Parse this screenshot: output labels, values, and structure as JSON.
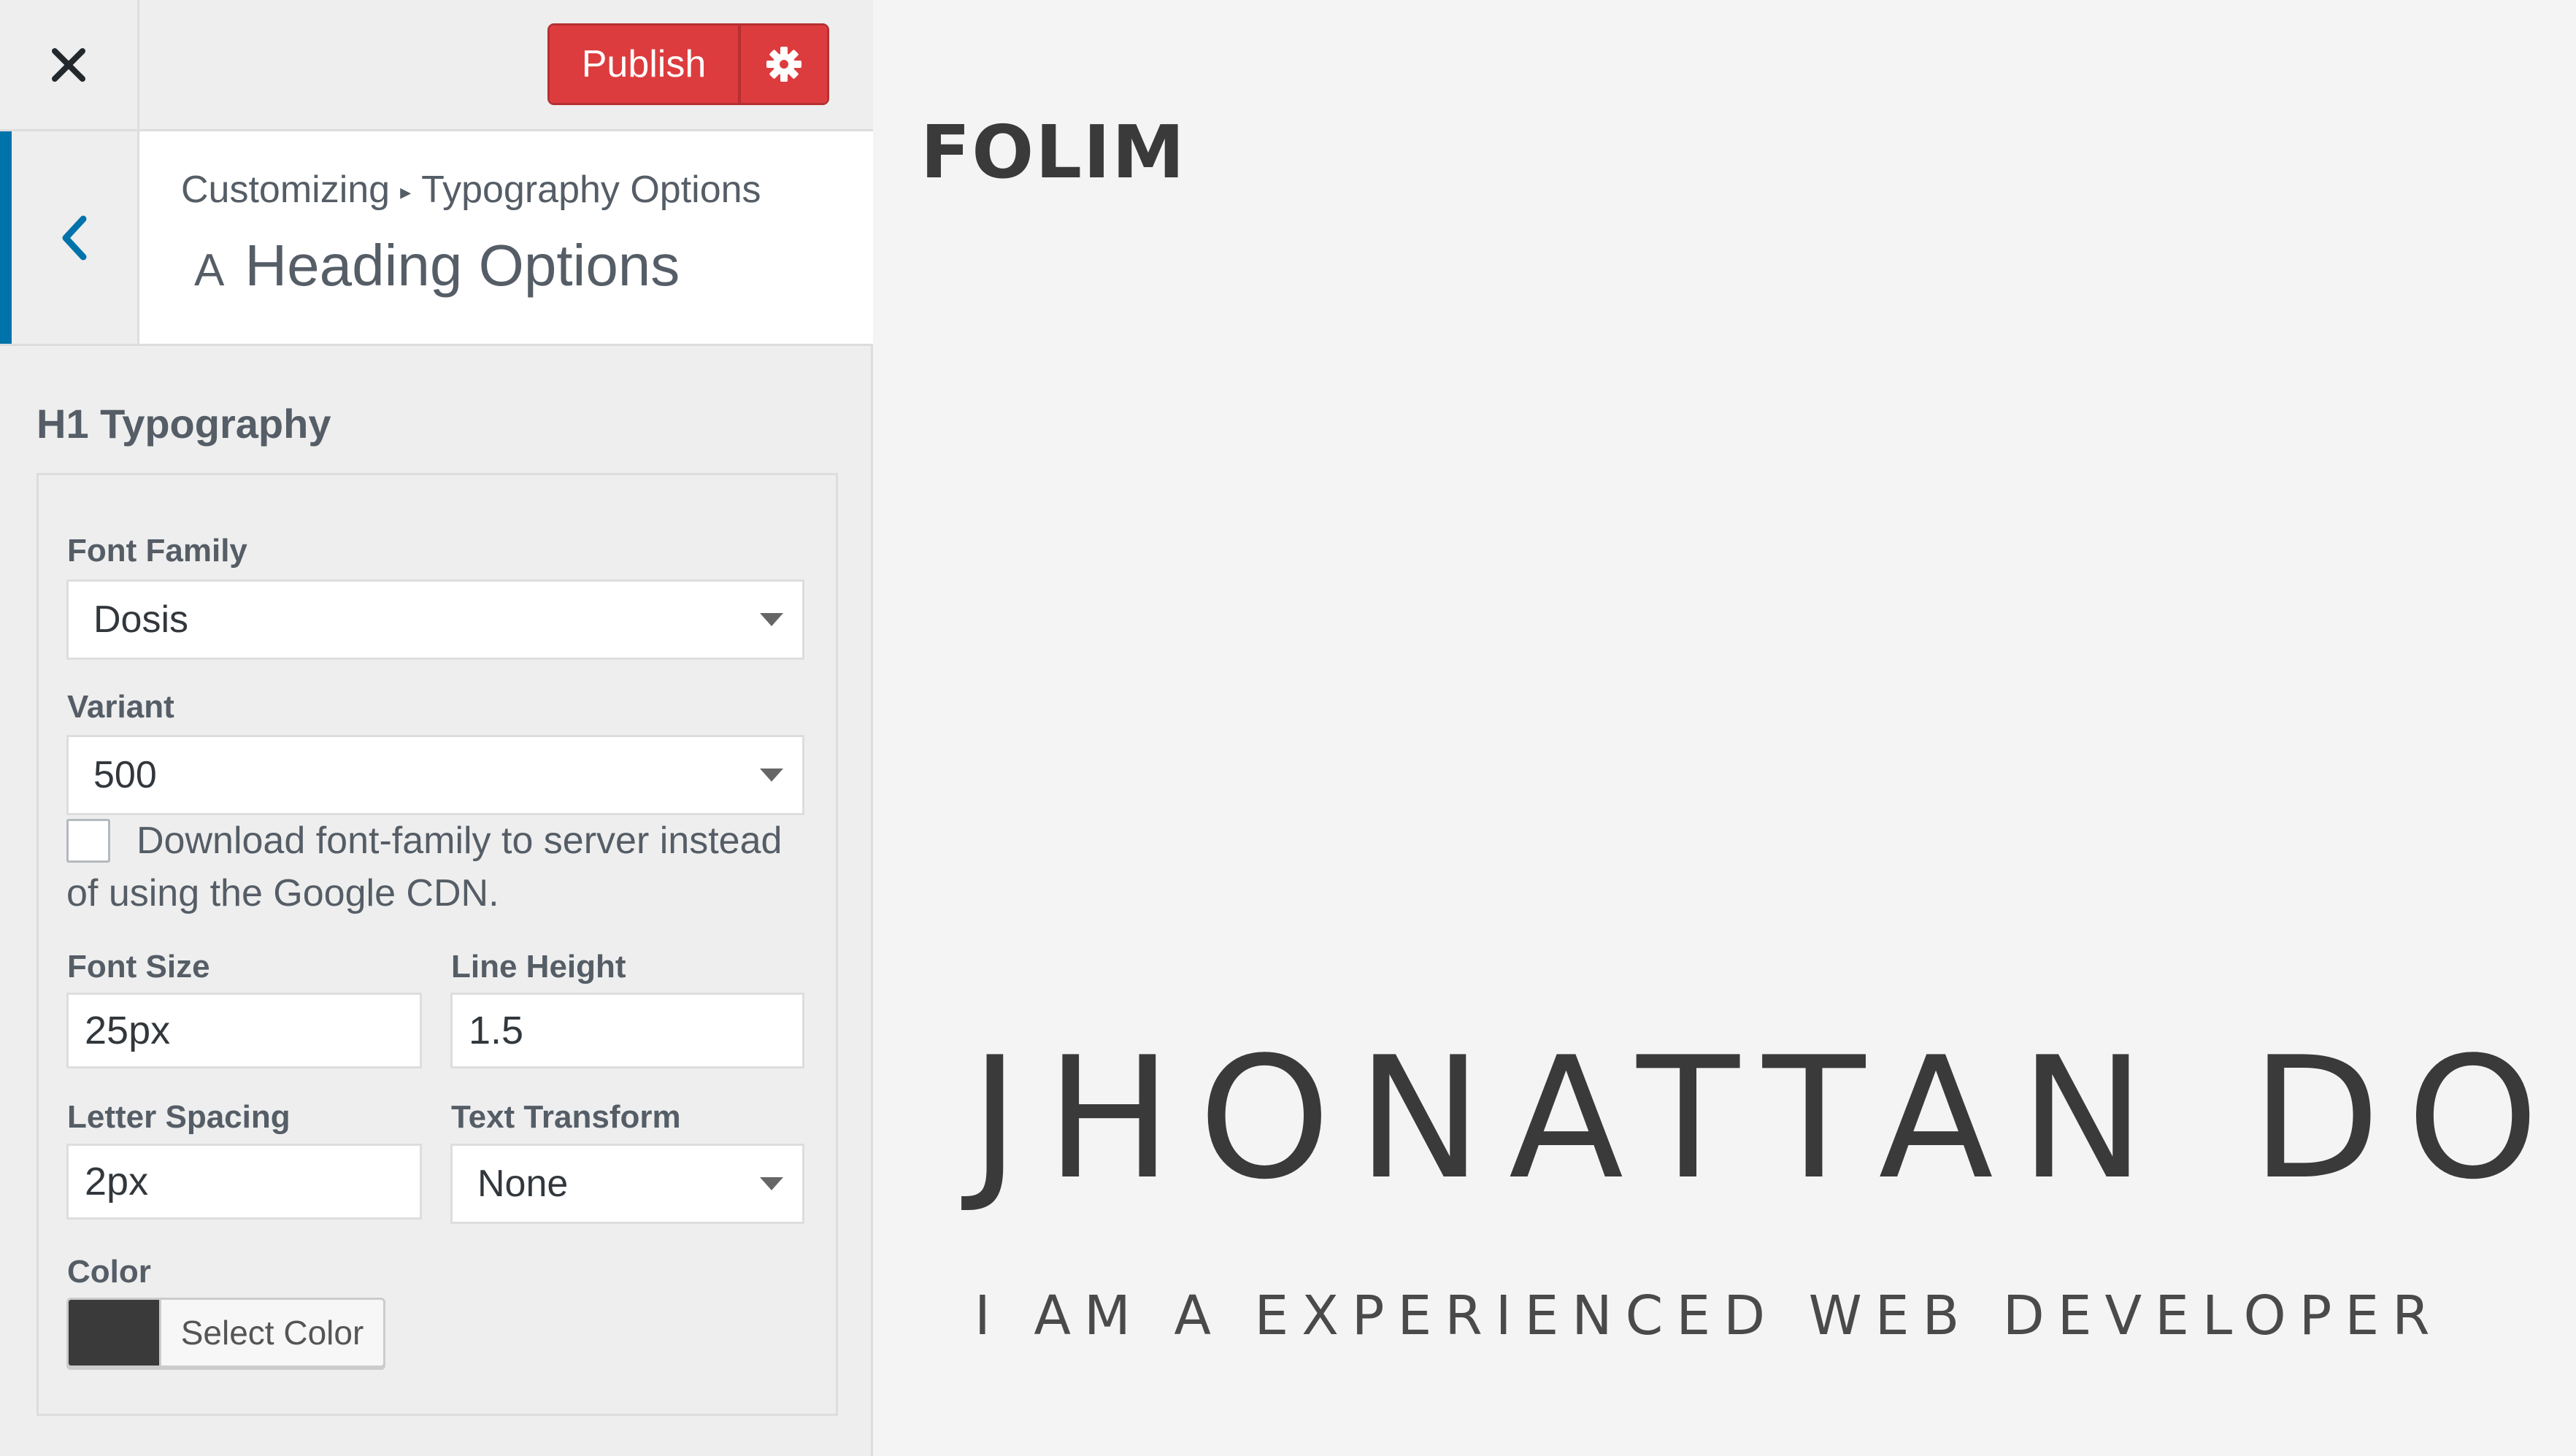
{
  "topbar": {
    "close_icon": "close-icon",
    "publish_label": "Publish",
    "settings_icon": "gear-icon"
  },
  "section": {
    "back_icon": "chevron-left-icon",
    "breadcrumb_root": "Customizing",
    "breadcrumb_separator": "▸",
    "breadcrumb_current": "Typography Options",
    "title_icon": "A",
    "title": "Heading Options"
  },
  "h1_typography": {
    "group_title": "H1 Typography",
    "font_family": {
      "label": "Font Family",
      "value": "Dosis"
    },
    "variant": {
      "label": "Variant",
      "value": "500"
    },
    "download_option": {
      "checked": false,
      "label": "Download font-family to server instead of using the Google CDN."
    },
    "font_size": {
      "label": "Font Size",
      "value": "25px"
    },
    "line_height": {
      "label": "Line Height",
      "value": "1.5"
    },
    "letter_spacing": {
      "label": "Letter Spacing",
      "value": "2px"
    },
    "text_transform": {
      "label": "Text Transform",
      "value": "None"
    },
    "color": {
      "label": "Color",
      "value": "#3a3a3a",
      "button_label": "Select Color"
    }
  },
  "preview": {
    "logo": "FOLIM",
    "hero_name": "JHONATTAN DOE",
    "tagline": "I AM A EXPERIENCED WEB DEVELOPER"
  },
  "colors": {
    "publish": "#dd3c3e",
    "accent": "#0073aa",
    "text": "#3a3a3a"
  }
}
